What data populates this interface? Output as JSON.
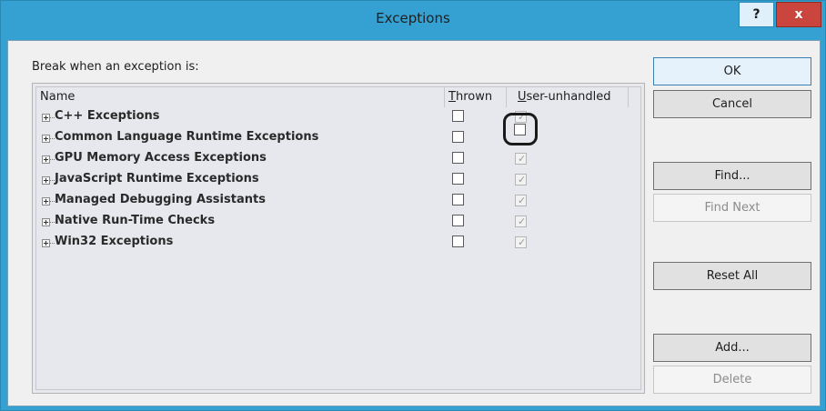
{
  "window": {
    "title": "Exceptions",
    "help_label": "?",
    "close_label": "x",
    "colors": {
      "titlebar": "#35a1d3",
      "close": "#c9453e"
    }
  },
  "break_label": "Break when an exception is:",
  "columns": {
    "name": "Name",
    "thrown": "Thrown",
    "user_unhandled": "User-unhandled"
  },
  "rows": [
    {
      "label": "C++ Exceptions",
      "thrown": false,
      "user_unhandled": true
    },
    {
      "label": "Common Language Runtime Exceptions",
      "thrown": false,
      "user_unhandled": false
    },
    {
      "label": "GPU Memory Access Exceptions",
      "thrown": false,
      "user_unhandled": true
    },
    {
      "label": "JavaScript Runtime Exceptions",
      "thrown": false,
      "user_unhandled": true
    },
    {
      "label": "Managed Debugging Assistants",
      "thrown": false,
      "user_unhandled": true
    },
    {
      "label": "Native Run-Time Checks",
      "thrown": false,
      "user_unhandled": true
    },
    {
      "label": "Win32 Exceptions",
      "thrown": false,
      "user_unhandled": true
    }
  ],
  "buttons": {
    "ok": "OK",
    "cancel": "Cancel",
    "find": "Find...",
    "find_next": "Find Next",
    "reset_all": "Reset All",
    "add": "Add...",
    "delete": "Delete"
  }
}
